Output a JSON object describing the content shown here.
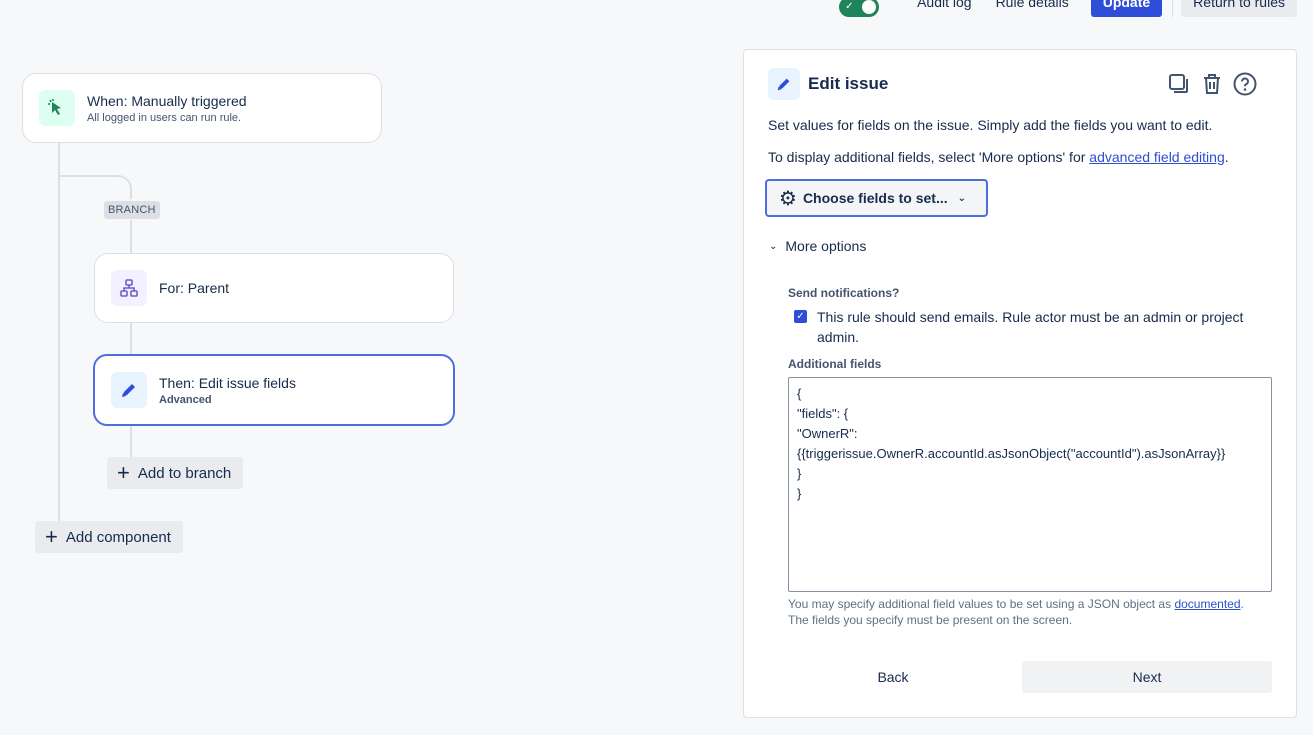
{
  "topbar": {
    "audit_log": "Audit log",
    "rule_details": "Rule details",
    "update": "Update",
    "return_to_rules": "Return to rules"
  },
  "canvas": {
    "trigger": {
      "title": "When: Manually triggered",
      "subtitle": "All logged in users can run rule.",
      "icon": "cursor-click-icon"
    },
    "branch_tag": "BRANCH",
    "branch": {
      "title": "For: Parent",
      "icon": "hierarchy-icon"
    },
    "action": {
      "title": "Then: Edit issue fields",
      "subtitle": "Advanced",
      "icon": "pencil-icon"
    },
    "add_to_branch": "Add to branch",
    "add_component": "Add component"
  },
  "panel": {
    "title": "Edit issue",
    "desc1": "Set values for fields on the issue. Simply add the fields you want to edit.",
    "desc2_prefix": "To display additional fields, select 'More options' for ",
    "desc2_link": "advanced field editing",
    "desc2_suffix": ".",
    "choose_fields": "Choose fields to set...",
    "more_options": "More options",
    "send_notifications_label": "Send notifications?",
    "send_notifications_text": "This rule should send emails. Rule actor must be an admin or project admin.",
    "send_notifications_checked": true,
    "additional_fields_label": "Additional fields",
    "additional_fields_value": "{\n\"fields\": {\n\"OwnerR\": \n{{triggerissue.OwnerR.accountId.asJsonObject(\"accountId\").asJsonArray}}\n}\n}",
    "help_prefix": "You may specify additional field values to be set using a JSON object as ",
    "help_link": "documented",
    "help_suffix": ".",
    "help_line2": "The fields you specify must be present on the screen.",
    "back": "Back",
    "next": "Next"
  },
  "colors": {
    "accent": "#2f4ed8",
    "selected_border": "#4c6ee0",
    "toggle_on": "#1f845a"
  }
}
